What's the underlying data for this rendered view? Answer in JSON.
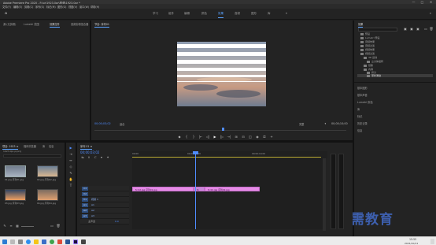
{
  "title_bar": {
    "title": "Adobe Premiere Pro 2020 - F:\\pr\\1923.0pr\\视频\\1923.0pr *",
    "minimize": "—",
    "maximize": "□",
    "close": "✕"
  },
  "menu": [
    "文件(F)",
    "编辑(E)",
    "剪辑(C)",
    "序列(S)",
    "标记(M)",
    "图形(G)",
    "视图(V)",
    "窗口(W)",
    "帮助(H)"
  ],
  "workspaces": [
    "学习",
    "组件",
    "编辑",
    "颜色",
    "效果",
    "音频",
    "图形",
    "库"
  ],
  "workspace_active_index": 4,
  "source_panel": {
    "tabs": [
      "源:(无剪辑)",
      "Lumetri 范围",
      "效果控件",
      "音频剪辑混合器"
    ],
    "active_tab_index": 2
  },
  "program_monitor": {
    "tab": "节目: 序列01",
    "timecode_left": "00;00;03;02",
    "zoom": "适合",
    "quality": "完整",
    "timecode_right": "00;00;10;00"
  },
  "transport": [
    "◆",
    "{",
    "}",
    "|←",
    "◁|",
    "▶",
    "|▷",
    "→|",
    "⊞",
    "⊟",
    "◫",
    "◉",
    "⎚",
    "+"
  ],
  "project_panel": {
    "tabs": [
      "项目: 1923 ≡",
      "媒体浏览器",
      "库",
      "信息"
    ],
    "path": "1923.0pr.prproj",
    "items": [
      {
        "label": "01.jpg 序列01.jpg",
        "colors": [
          "#707b8c",
          "#a8b2c0"
        ]
      },
      {
        "label": "02.jpg 序列02.jpg",
        "colors": [
          "#6b7f96",
          "#d9b790"
        ]
      },
      {
        "label": "03.jpg 序列03.jpg",
        "colors": [
          "#314563",
          "#f0a060"
        ]
      },
      {
        "label": "04.jpg 序列04.jpg",
        "colors": [
          "#7b6c60",
          "#e0a070"
        ]
      }
    ]
  },
  "timeline": {
    "tab": "序列 01 ≡",
    "timecode": "00;00;03;02",
    "ruler": [
      "00;00",
      "00;00;05;00",
      "00;00;10;00"
    ],
    "tracks": [
      {
        "toggle": "V3",
        "name": ""
      },
      {
        "toggle": "V2",
        "name": ""
      },
      {
        "toggle": "V1",
        "name": "视频 1"
      },
      {
        "toggle": "A1",
        "name": "A1"
      },
      {
        "toggle": "A2",
        "name": "A2"
      },
      {
        "toggle": "A3",
        "name": "A3"
      },
      {
        "toggle": "",
        "name": "主声道"
      }
    ],
    "master_value": "0.0",
    "clips": [
      {
        "label": "fx 02.jpg 序列01.jpg"
      },
      {
        "label": "fx"
      },
      {
        "label": "fx 02.jpg 序列02.jpg"
      }
    ]
  },
  "effects_panel": {
    "header": "效果",
    "tree": [
      "预设",
      "Lumetri 预设",
      "音频效果",
      "音频过渡",
      "视频效果",
      "视频过渡",
      "3D 运动",
      "立方体旋转",
      "划像",
      "内滑",
      "拆分",
      "带状滑动"
    ],
    "sections": [
      "基本图形",
      "基本声音",
      "Lumetri 颜色",
      "库",
      "标记",
      "历史记录",
      "信息"
    ]
  },
  "tools": [
    "▶",
    "⇥",
    "↔",
    "◇",
    "✎",
    "✋",
    "T"
  ],
  "watermark": "最需教育",
  "taskbar": {
    "time": "15:55",
    "date": "2021/10/11"
  }
}
